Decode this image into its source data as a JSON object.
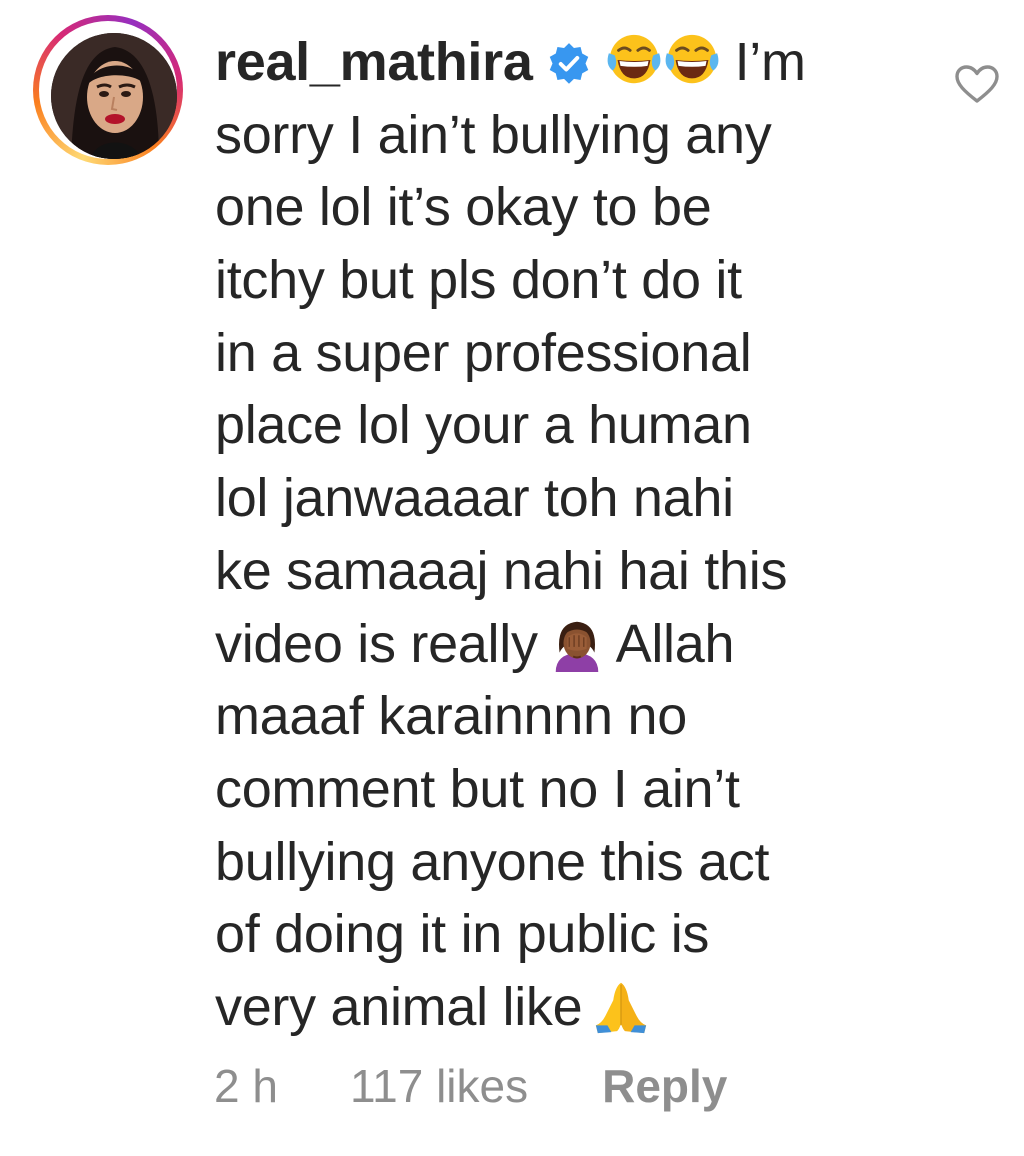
{
  "comment": {
    "username": "real_mathira",
    "verified": true,
    "lines": [
      "I’m",
      "sorry I ain’t bullying any",
      "one lol it’s okay to be",
      "itchy but pls don’t do it",
      "in a super professional",
      "place lol your a human",
      "lol janwaaaar toh nahi",
      "ke samaaaj nahi hai this",
      "video is really",
      "Allah",
      "maaaf karainnnn no",
      "comment but no I ain’t",
      "bullying anyone this act",
      "of doing it in public is",
      "very animal like"
    ],
    "emojis": {
      "laugh": "face-with-tears-of-joy",
      "facepalm": "person-facepalming",
      "pray": "folded-hands"
    }
  },
  "meta": {
    "time": "2 h",
    "likes": "117 likes",
    "reply": "Reply"
  },
  "icons": {
    "like": "heart-outline-icon",
    "verified": "verified-badge-icon"
  },
  "colors": {
    "text": "#262626",
    "muted": "#8e8e8e",
    "verified_blue": "#3897f0"
  }
}
